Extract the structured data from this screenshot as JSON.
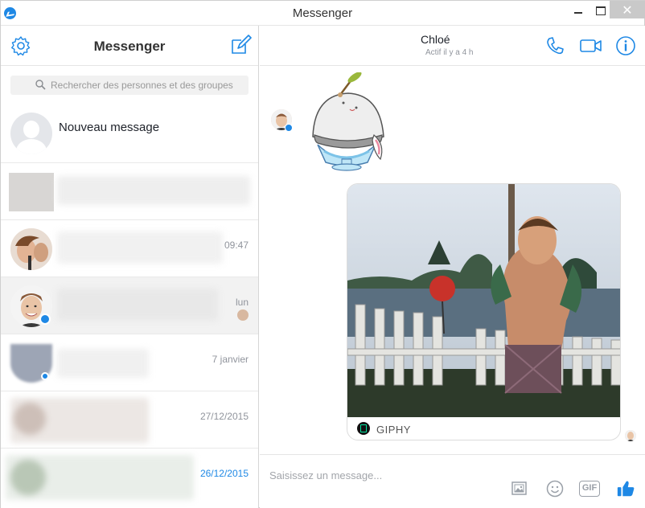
{
  "window": {
    "title": "Messenger",
    "close_glyph": "✕"
  },
  "sidebar": {
    "title": "Messenger",
    "search_placeholder": "Rechercher des personnes et des groupes",
    "new_message_label": "Nouveau message",
    "conversations": [
      {
        "time": ""
      },
      {
        "time": "09:47"
      },
      {
        "time": "lun"
      },
      {
        "time": "7 janvier"
      },
      {
        "time": "27/12/2015"
      },
      {
        "time": "26/12/2015"
      }
    ]
  },
  "chat": {
    "contact_name": "Chloé",
    "contact_status": "Actif il y a 4 h",
    "gif_source_label": "GIPHY",
    "composer_placeholder": "Saisissez un message...",
    "gif_button_label": "GIF"
  },
  "colors": {
    "accent": "#1e88e5",
    "muted": "#90949c"
  },
  "icons": {
    "settings": "gear-icon",
    "compose": "compose-icon",
    "search": "search-icon",
    "call": "phone-icon",
    "video": "video-camera-icon",
    "info": "info-icon",
    "photo": "photo-icon",
    "emoji": "emoji-icon",
    "gif": "gif-icon",
    "like": "thumbs-up-icon"
  }
}
